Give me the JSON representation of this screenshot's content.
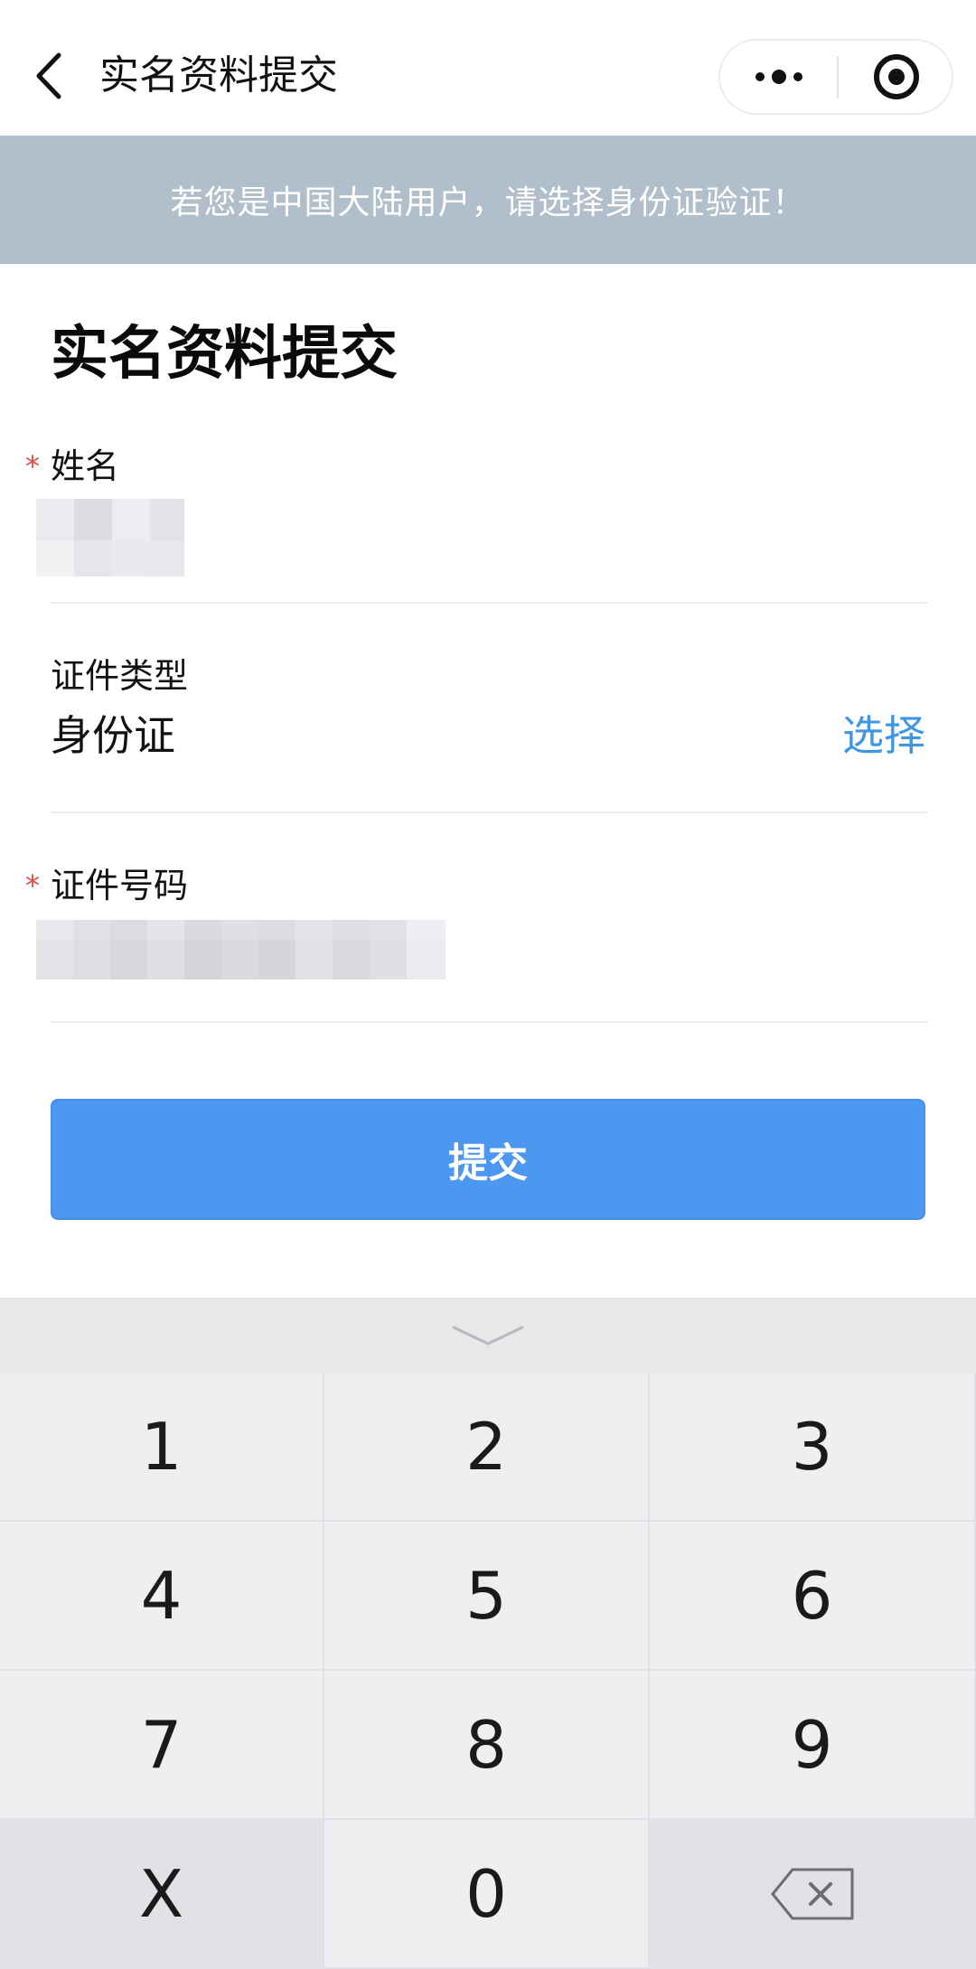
{
  "navbar": {
    "title": "实名资料提交",
    "back_icon": "chevron-left-icon",
    "more_icon": "more-dots-icon",
    "close_icon": "target-circle-icon"
  },
  "notice": {
    "text": "若您是中国大陆用户，请选择身份证验证！",
    "background": "#b1bfcc"
  },
  "form": {
    "heading": "实名资料提交",
    "name_field": {
      "required_mark": "*",
      "label": "姓名"
    },
    "id_type_field": {
      "label": "证件类型",
      "value": "身份证",
      "action": "选择"
    },
    "id_number_field": {
      "required_mark": "*",
      "label": "证件号码"
    },
    "submit_label": "提交"
  },
  "keyboard": {
    "collapse_icon": "chevron-down-icon",
    "keys": [
      "1",
      "2",
      "3",
      "4",
      "5",
      "6",
      "7",
      "8",
      "9",
      "X",
      "0"
    ],
    "backspace_icon": "backspace-icon"
  },
  "colors": {
    "accent": "#4c98f1",
    "link": "#3f97e4",
    "required": "#e0483b",
    "keyboard_bg": "#e8e8ea"
  }
}
